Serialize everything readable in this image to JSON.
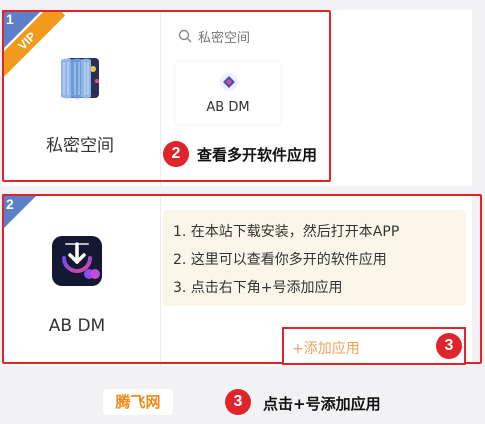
{
  "private_space": {
    "corner_number": "1",
    "vip_label": "VIP",
    "app_label": "私密空间",
    "search_placeholder": "私密空间",
    "cloned_app_name": "AB DM",
    "callout_number": "2",
    "callout_text": "查看多开软件应用"
  },
  "ab_dm": {
    "corner_number": "2",
    "app_label": "AB DM",
    "instructions": [
      "1. 在本站下载安装，然后打开本APP",
      "2. 这里可以查看你多开的软件应用",
      "3. 点击右下角+号添加应用"
    ],
    "add_button_label": "+添加应用",
    "add_badge_number": "3"
  },
  "footer": {
    "brand": "腾飞网",
    "badge_number": "3",
    "text": "点击+号添加应用"
  },
  "colors": {
    "accent_red": "#e0242b",
    "vip_orange": "#f29a1c",
    "corner_blue": "#5b7fc9",
    "tip_background": "#fbf6ea",
    "add_placeholder": "#f3a05b"
  }
}
